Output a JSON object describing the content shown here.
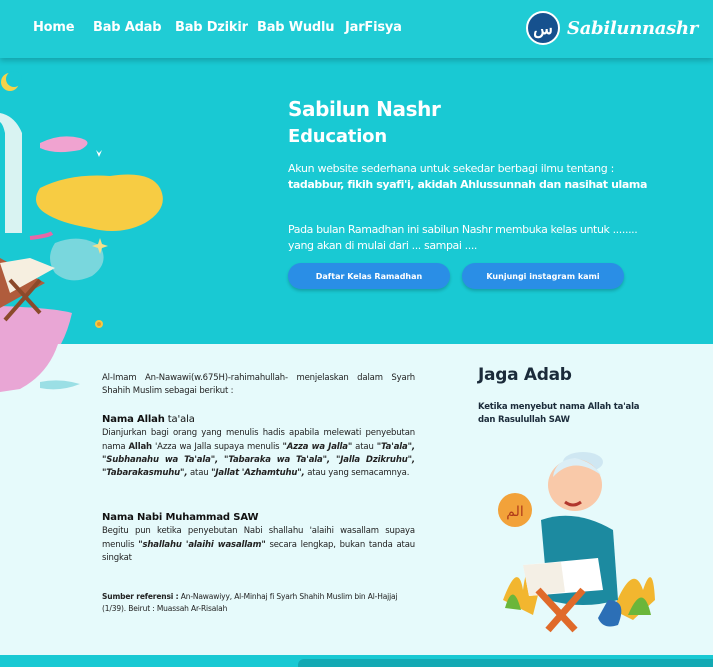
{
  "nav": {
    "links": [
      "Home",
      "Bab Adab",
      "Bab Dzikir",
      "Bab Wudlu",
      "JarFisya"
    ],
    "brand_logo_text": "س",
    "brand_name": "Sabilunnashr"
  },
  "hero": {
    "title": "Sabilun Nashr",
    "subtitle": "Education",
    "desc_line1": "Akun website sederhana untuk sekedar berbagi ilmu tentang :",
    "desc_line2": "tadabbur, fikih syafi'i, akidah Ahlussunnah dan nasihat ulama",
    "desc_ramadhan": "Pada bulan Ramadhan ini sabilun Nashr membuka kelas untuk ........ yang akan di mulai dari ... sampai ....",
    "btn_daftar": "Daftar Kelas Ramadhan",
    "btn_instagram": "Kunjungi instagram kami"
  },
  "article": {
    "intro": "Al-Imam An-Nawawi(w.675H)-rahimahullah- menjelaskan dalam Syarh Shahih Muslim sebagai berikut :",
    "s1_head_bold": "Nama Allah",
    "s1_head_light": " ta'ala",
    "s1_t1": "Dianjurkan bagi orang yang menulis hadis apabila melewati penyebutan nama ",
    "s1_b1": "Allah",
    "s1_t2": " 'Azza wa Jalla supaya menulis ",
    "s1_b2": "\"Azza wa Jalla\"",
    "s1_t3": " atau ",
    "s1_b3": "\"Ta'ala\", \"Subhanahu wa Ta'ala\", \"Tabaraka wa Ta'ala\", \"Jalla Dzikruhu\", \"Tabarakasmuhu\",",
    "s1_t4": " atau ",
    "s1_b4": "\"Jallat 'Azhamtuhu\",",
    "s1_t5": " atau yang semacamnya.",
    "s2_head": "Nama Nabi Muhammad SAW",
    "s2_t1": "Begitu pun ketika penyebutan Nabi shallahu 'alaihi wasallam supaya menulis ",
    "s2_b1": "\"shallahu 'alaihi wasallam\"",
    "s2_t2": " secara lengkap, bukan tanda atau singkat",
    "ref_label": "Sumber referensi :",
    "ref_text": " An-Nawawiyy, Al-Minhaj fi Syarh Shahih Muslim bin Al-Hajjaj (1/39). Beirut : Muassah Ar-Risalah"
  },
  "sidebar": {
    "title": "Jaga Adab",
    "desc": "Ketika menyebut nama Allah ta'ala dan Rasulullah SAW",
    "badge_text": "الم"
  },
  "colors": {
    "primary": "#19c9d3",
    "button": "#2a8ee6",
    "page_bg": "#e6fafb",
    "brand_logo": "#16518e"
  },
  "icons": [
    "crescent-moon-icon",
    "quran-rehal-icon",
    "boy-reading-quran-illustration"
  ]
}
